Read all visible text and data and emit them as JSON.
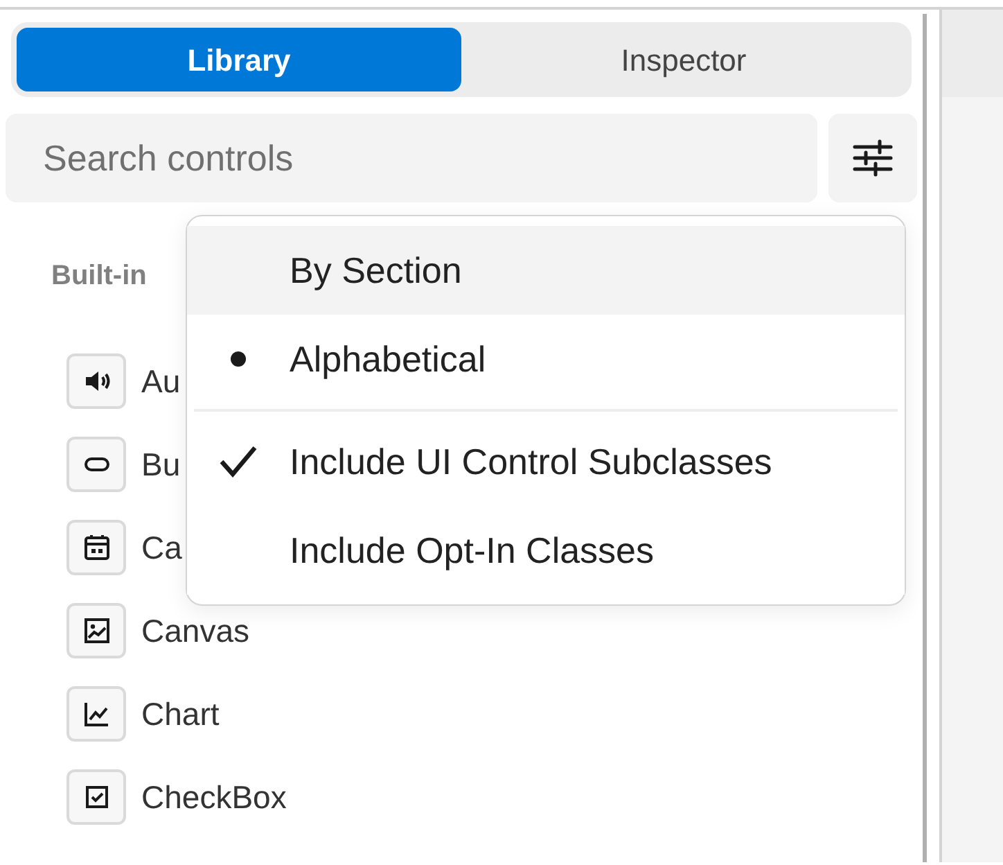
{
  "tabs": [
    {
      "label": "Library",
      "selected": true
    },
    {
      "label": "Inspector",
      "selected": false
    }
  ],
  "search": {
    "placeholder": "Search controls"
  },
  "section": {
    "title": "Built-in"
  },
  "controls": [
    {
      "label": "Au"
    },
    {
      "label": "Bu"
    },
    {
      "label": "Ca"
    },
    {
      "label": "Canvas"
    },
    {
      "label": "Chart"
    },
    {
      "label": "CheckBox"
    }
  ],
  "sort_menu": {
    "groups": [
      {
        "items": [
          {
            "kind": "radio",
            "label": "By Section",
            "selected": false,
            "highlighted": true
          },
          {
            "kind": "radio",
            "label": "Alphabetical",
            "selected": true,
            "highlighted": false
          }
        ]
      },
      {
        "items": [
          {
            "kind": "check",
            "label": "Include UI Control Subclasses",
            "checked": true,
            "highlighted": false
          },
          {
            "kind": "check",
            "label": "Include Opt-In Classes",
            "checked": false,
            "highlighted": false
          }
        ]
      }
    ]
  }
}
